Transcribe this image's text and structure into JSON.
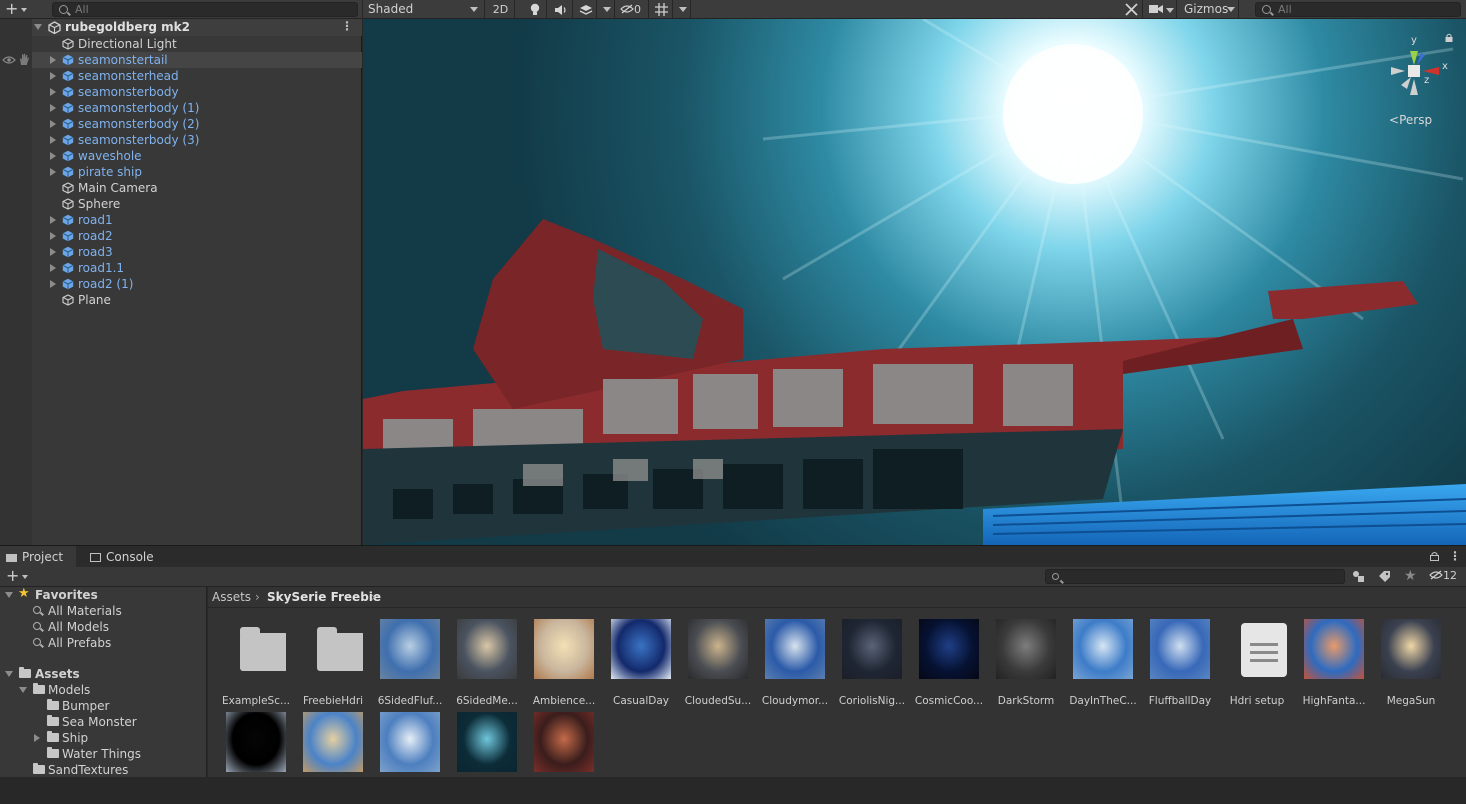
{
  "hierarchy": {
    "search_placeholder": "All",
    "scene_name": "rubegoldberg mk2",
    "items": [
      {
        "label": "Directional Light",
        "prefab": false,
        "expandable": false
      },
      {
        "label": "seamonstertail",
        "prefab": true,
        "expandable": true
      },
      {
        "label": "seamonsterhead",
        "prefab": true,
        "expandable": true
      },
      {
        "label": "seamonsterbody",
        "prefab": true,
        "expandable": true
      },
      {
        "label": "seamonsterbody (1)",
        "prefab": true,
        "expandable": true
      },
      {
        "label": "seamonsterbody (2)",
        "prefab": true,
        "expandable": true
      },
      {
        "label": "seamonsterbody (3)",
        "prefab": true,
        "expandable": true
      },
      {
        "label": "waveshole",
        "prefab": true,
        "expandable": true
      },
      {
        "label": "pirate ship",
        "prefab": true,
        "expandable": true
      },
      {
        "label": "Main Camera",
        "prefab": false,
        "expandable": false
      },
      {
        "label": "Sphere",
        "prefab": false,
        "expandable": false
      },
      {
        "label": "road1",
        "prefab": true,
        "expandable": true
      },
      {
        "label": "road2",
        "prefab": true,
        "expandable": true
      },
      {
        "label": "road3",
        "prefab": true,
        "expandable": true
      },
      {
        "label": "road1.1",
        "prefab": true,
        "expandable": true
      },
      {
        "label": "road2 (1)",
        "prefab": true,
        "expandable": true
      },
      {
        "label": "Plane",
        "prefab": false,
        "expandable": false
      }
    ]
  },
  "scene_toolbar": {
    "shading_mode": "Shaded",
    "mode_2d": "2D",
    "hidden_count": "0",
    "gizmos_label": "Gizmos",
    "search_placeholder": "All",
    "projection_label": "Persp"
  },
  "gizmo_axes": {
    "x": "x",
    "y": "y",
    "z": "z"
  },
  "bottom_tabs": {
    "project": "Project",
    "console": "Console"
  },
  "project_toolbar": {
    "hidden_count": "12"
  },
  "project_tree": {
    "favorites_label": "Favorites",
    "favorites": [
      "All Materials",
      "All Models",
      "All Prefabs"
    ],
    "assets_label": "Assets",
    "models_label": "Models",
    "model_children": [
      "Bumper",
      "Sea Monster",
      "Ship",
      "Water Things"
    ],
    "sand_textures": "SandTextures"
  },
  "breadcrumb": {
    "root": "Assets",
    "current": "SkySerie Freebie"
  },
  "assets": [
    {
      "name": "ExampleSc...",
      "kind": "folder"
    },
    {
      "name": "FreebieHdri",
      "kind": "folder"
    },
    {
      "name": "6SidedFluf...",
      "kind": "sky",
      "c1": "#3f6fae",
      "c2": "#b8cfe3",
      "c3": "#6a84a0"
    },
    {
      "name": "6SidedMe...",
      "kind": "sky",
      "c1": "#4a5360",
      "c2": "#d9c7a6",
      "c3": "#3b3b3d"
    },
    {
      "name": "Ambience...",
      "kind": "sky",
      "c1": "#c9b69d",
      "c2": "#f3e0b6",
      "c3": "#b07a4f"
    },
    {
      "name": "CasualDay",
      "kind": "sky",
      "c1": "#13296b",
      "c2": "#3a73c4",
      "c3": "#e4ecf7"
    },
    {
      "name": "CloudedSu...",
      "kind": "sky",
      "c1": "#4a4d53",
      "c2": "#cbb48c",
      "c3": "#2a2a2c"
    },
    {
      "name": "Cloudymor...",
      "kind": "sky",
      "c1": "#2b5aa8",
      "c2": "#d8e3ee",
      "c3": "#5c7fb0"
    },
    {
      "name": "CoriolisNig...",
      "kind": "sky",
      "c1": "#1f2634",
      "c2": "#5a6477",
      "c3": "#1b1f28"
    },
    {
      "name": "CosmicCoo...",
      "kind": "sky",
      "c1": "#061233",
      "c2": "#1f3f86",
      "c3": "#050814"
    },
    {
      "name": "DarkStorm",
      "kind": "sky",
      "c1": "#3b3b3b",
      "c2": "#7d7d7d",
      "c3": "#222222"
    },
    {
      "name": "DayInTheC...",
      "kind": "sky",
      "c1": "#3d7cc8",
      "c2": "#d6e6f4",
      "c3": "#7aa4d4"
    },
    {
      "name": "FluffballDay",
      "kind": "sky",
      "c1": "#3868b8",
      "c2": "#cfdff0",
      "c3": "#5a86c2"
    },
    {
      "name": "Hdri setup",
      "kind": "doc"
    },
    {
      "name": "HighFanta...",
      "kind": "sky",
      "c1": "#2e6bc0",
      "c2": "#e89a6a",
      "c3": "#c4533a"
    },
    {
      "name": "MegaSun",
      "kind": "sky",
      "c1": "#3b4150",
      "c2": "#f0d7a6",
      "c3": "#2a2c33"
    },
    {
      "name": "",
      "kind": "sky",
      "c1": "#000000",
      "c2": "#050505",
      "c3": "#9aa6b7"
    },
    {
      "name": "",
      "kind": "sky",
      "c1": "#4b83c8",
      "c2": "#e5d0a2",
      "c3": "#c19b66"
    },
    {
      "name": "",
      "kind": "sky",
      "c1": "#4d7fbf",
      "c2": "#e6eef6",
      "c3": "#7ea2cc"
    },
    {
      "name": "",
      "kind": "sky",
      "c1": "#0c2c38",
      "c2": "#6fc6dc",
      "c3": "#0a2530"
    },
    {
      "name": "",
      "kind": "sky",
      "c1": "#3a1d1c",
      "c2": "#c46a48",
      "c3": "#7a2f2a"
    }
  ],
  "colors": {
    "prefab_text": "#7fb2ee",
    "panel": "#383838",
    "selection": "#454545"
  }
}
